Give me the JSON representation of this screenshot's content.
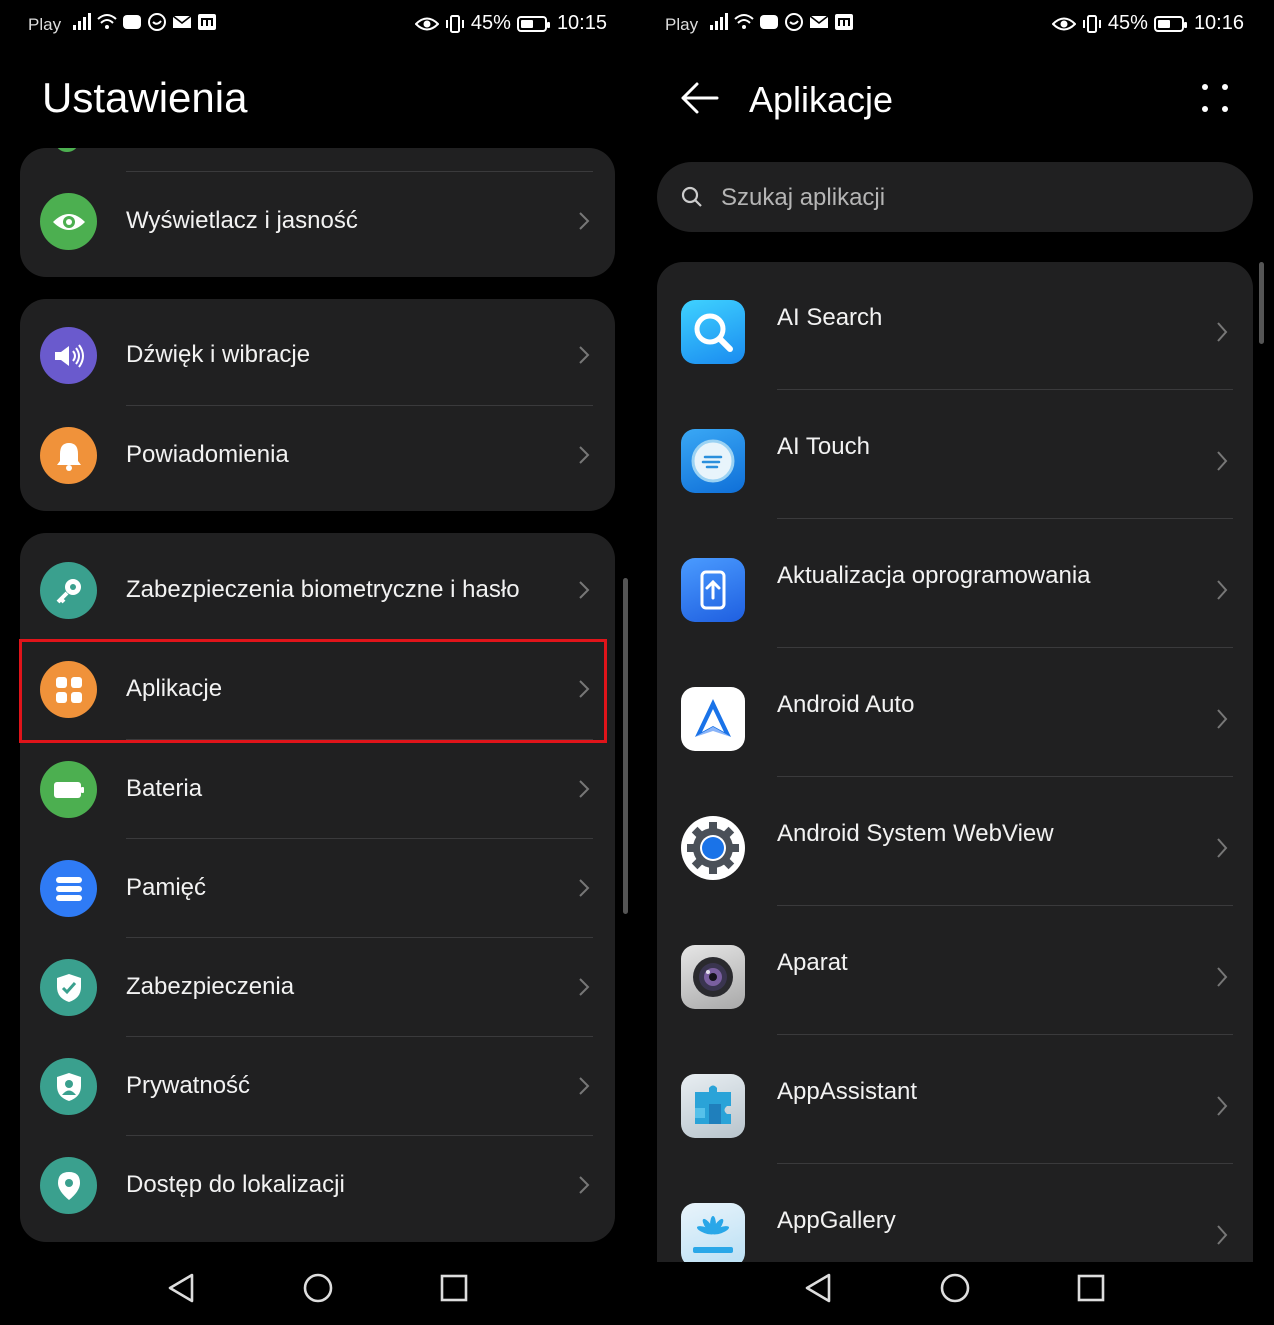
{
  "left": {
    "status": {
      "carrier": "Play",
      "battery": "45%",
      "time": "10:15"
    },
    "title": "Ustawienia",
    "cards": [
      {
        "items": [
          {
            "label": "Wyświetlacz i jasność",
            "icon": "eye-icon",
            "color": "#4caf50"
          }
        ]
      },
      {
        "items": [
          {
            "label": "Dźwięk i wibracje",
            "icon": "speaker-icon",
            "color": "#6a5acd"
          },
          {
            "label": "Powiadomienia",
            "icon": "bell-icon",
            "color": "#f0923a"
          }
        ]
      },
      {
        "items": [
          {
            "label": "Zabezpieczenia biometryczne i hasło",
            "icon": "key-icon",
            "color": "#3aa08e"
          },
          {
            "label": "Aplikacje",
            "icon": "apps-grid-icon",
            "color": "#f0923a"
          },
          {
            "label": "Bateria",
            "icon": "battery-icon",
            "color": "#4caf50"
          },
          {
            "label": "Pamięć",
            "icon": "storage-icon",
            "color": "#2f7bf5"
          },
          {
            "label": "Zabezpieczenia",
            "icon": "shield-icon",
            "color": "#3aa08e"
          },
          {
            "label": "Prywatność",
            "icon": "privacy-icon",
            "color": "#3aa08e"
          },
          {
            "label": "Dostęp do lokalizacji",
            "icon": "location-pin-icon",
            "color": "#3aa08e"
          }
        ]
      }
    ],
    "highlight_color": "#e0141a"
  },
  "right": {
    "status": {
      "carrier": "Play",
      "battery": "45%",
      "time": "10:16"
    },
    "title": "Aplikacje",
    "search": {
      "placeholder": "Szukaj aplikacji",
      "value": ""
    },
    "apps": [
      {
        "label": "AI Search",
        "icon": "ai-search-icon"
      },
      {
        "label": "AI Touch",
        "icon": "ai-touch-icon"
      },
      {
        "label": "Aktualizacja oprogramowania",
        "icon": "software-update-icon"
      },
      {
        "label": "Android Auto",
        "icon": "android-auto-icon"
      },
      {
        "label": "Android System WebView",
        "icon": "webview-gear-icon"
      },
      {
        "label": "Aparat",
        "icon": "camera-icon"
      },
      {
        "label": "AppAssistant",
        "icon": "puzzle-icon"
      },
      {
        "label": "AppGallery",
        "icon": "appgallery-icon"
      }
    ]
  }
}
